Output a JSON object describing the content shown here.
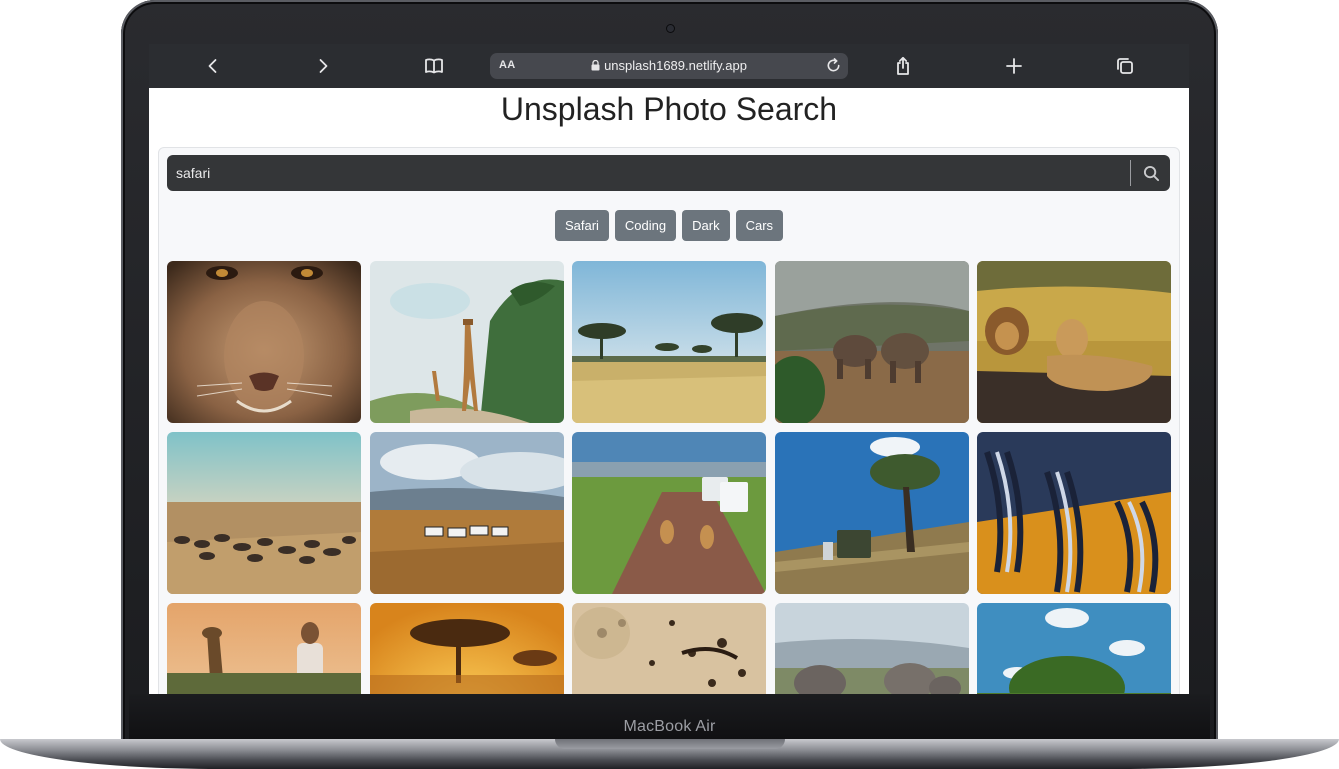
{
  "browser": {
    "url": "unsplash1689.netlify.app",
    "reader_label": "AA"
  },
  "page": {
    "title": "Unsplash Photo Search"
  },
  "search": {
    "value": "safari",
    "placeholder": ""
  },
  "chips": [
    {
      "label": "Safari"
    },
    {
      "label": "Coding"
    },
    {
      "label": "Dark"
    },
    {
      "label": "Cars"
    }
  ],
  "device": {
    "label": "MacBook Air"
  },
  "colors": {
    "chip_bg": "#6c757d",
    "search_bg": "#343638",
    "toolbar_bg": "#2b2d31"
  },
  "icons": [
    "back-icon",
    "forward-icon",
    "bookmarks-icon",
    "lock-icon",
    "reload-icon",
    "share-icon",
    "new-tab-icon",
    "tabs-icon",
    "search-icon"
  ]
}
